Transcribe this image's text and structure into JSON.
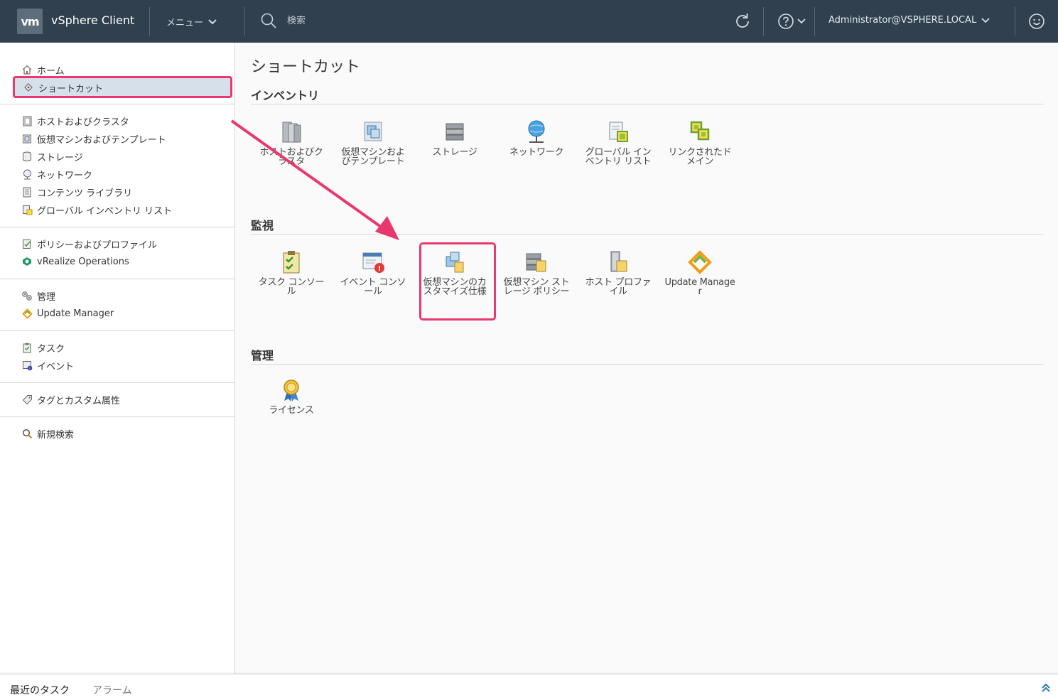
{
  "header": {
    "logo": "vm",
    "app_title": "vSphere Client",
    "menu_label": "メニュー",
    "search_placeholder": "検索",
    "user_label": "Administrator@VSPHERE.LOCAL",
    "bg_color": "#30404f"
  },
  "sidebar": {
    "home": "ホーム",
    "shortcuts": "ショートカット",
    "group1": [
      {
        "label": "ホストおよびクラスタ",
        "icon": "hosts-clusters-icon"
      },
      {
        "label": "仮想マシンおよびテンプレート",
        "icon": "vm-templates-icon"
      },
      {
        "label": "ストレージ",
        "icon": "storage-icon"
      },
      {
        "label": "ネットワーク",
        "icon": "network-icon"
      },
      {
        "label": "コンテンツ ライブラリ",
        "icon": "content-library-icon"
      },
      {
        "label": "グローバル インベントリ リスト",
        "icon": "global-inventory-icon"
      }
    ],
    "group2": [
      {
        "label": "ポリシーおよびプロファイル",
        "icon": "policies-icon"
      },
      {
        "label": "vRealize Operations",
        "icon": "vrealize-icon"
      }
    ],
    "group3": [
      {
        "label": "管理",
        "icon": "administration-icon"
      },
      {
        "label": "Update Manager",
        "icon": "update-manager-icon"
      }
    ],
    "group4": [
      {
        "label": "タスク",
        "icon": "tasks-icon"
      },
      {
        "label": "イベント",
        "icon": "events-icon"
      }
    ],
    "tags": "タグとカスタム属性",
    "new_search": "新規検索",
    "highlight_color": "#e8386d",
    "selected_bg": "#d5e0ea"
  },
  "main": {
    "title": "ショートカット",
    "sections": {
      "inventory": {
        "title": "インベントリ",
        "tiles": [
          {
            "label": "ホストおよびクラスタ",
            "icon": "hosts-clusters-icon"
          },
          {
            "label": "仮想マシンおよびテンプレート",
            "icon": "vm-templates-icon"
          },
          {
            "label": "ストレージ",
            "icon": "storage-icon"
          },
          {
            "label": "ネットワーク",
            "icon": "network-icon"
          },
          {
            "label": "グローバル インベントリ リスト",
            "icon": "global-inventory-icon"
          },
          {
            "label": "リンクされたドメイン",
            "icon": "linked-domains-icon"
          }
        ]
      },
      "monitoring": {
        "title": "監視",
        "tiles": [
          {
            "label": "タスク コンソール",
            "icon": "task-console-icon"
          },
          {
            "label": "イベント コンソール",
            "icon": "event-console-icon"
          },
          {
            "label": "仮想マシンのカスタマイズ仕様",
            "icon": "vm-customization-specs-icon"
          },
          {
            "label": "仮想マシン ストレージ ポリシー",
            "icon": "vm-storage-policies-icon"
          },
          {
            "label": "ホスト プロファイル",
            "icon": "host-profiles-icon"
          },
          {
            "label": "Update Manager",
            "icon": "update-manager-icon"
          }
        ]
      },
      "administration": {
        "title": "管理",
        "tiles": [
          {
            "label": "ライセンス",
            "icon": "licensing-icon"
          }
        ]
      }
    }
  },
  "bottom": {
    "recent_tasks": "最近のタスク",
    "alarms": "アラーム"
  },
  "annotation": {
    "arrow_color": "#e8386d"
  }
}
